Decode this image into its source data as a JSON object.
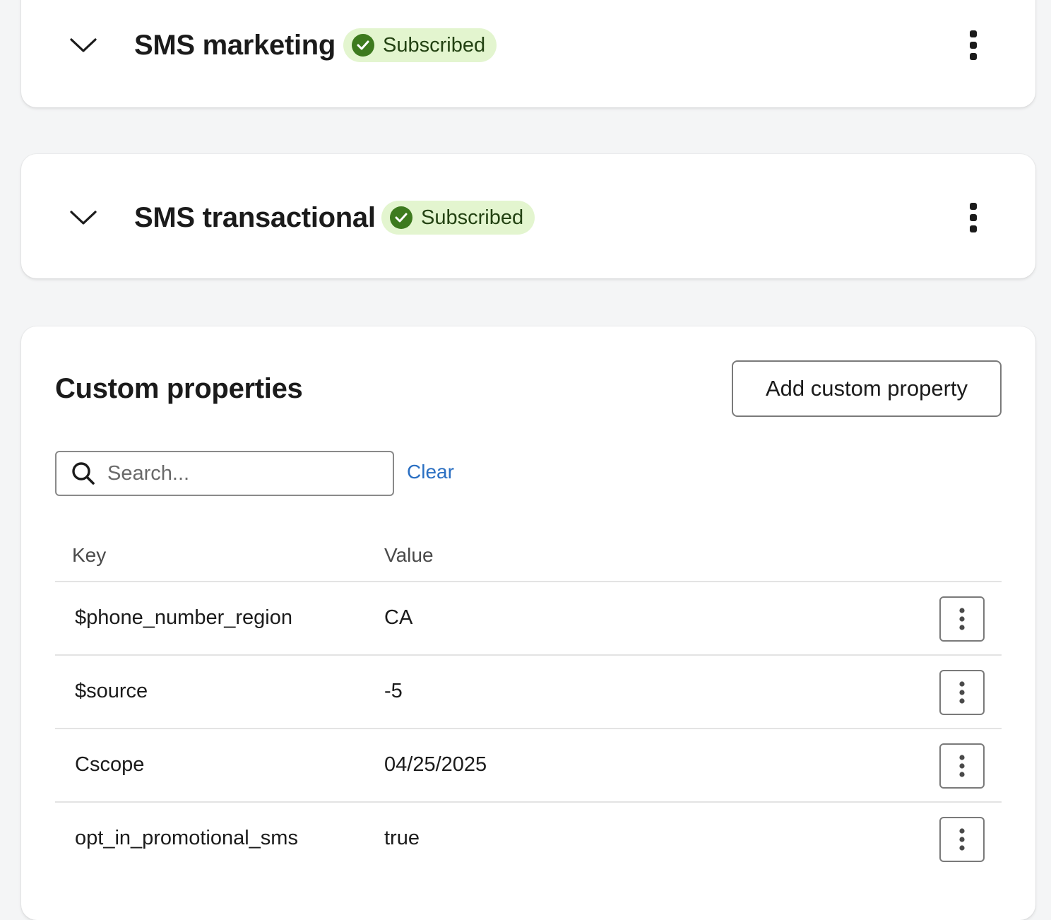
{
  "channels": [
    {
      "title": "SMS marketing",
      "status": "Subscribed"
    },
    {
      "title": "SMS transactional",
      "status": "Subscribed"
    }
  ],
  "custom_properties": {
    "title": "Custom properties",
    "add_button_label": "Add custom property",
    "search": {
      "placeholder": "Search...",
      "value": ""
    },
    "clear_label": "Clear",
    "columns": {
      "key": "Key",
      "value": "Value"
    },
    "rows": [
      {
        "key": "$phone_number_region",
        "value": "CA"
      },
      {
        "key": "$source",
        "value": "-5"
      },
      {
        "key": "Cscope",
        "value": "04/25/2025"
      },
      {
        "key": "opt_in_promotional_sms",
        "value": "true"
      }
    ]
  },
  "colors": {
    "badge_bg": "#e3f5cf",
    "badge_check": "#3d7a1e",
    "link": "#2a6fc2",
    "page_bg": "#f4f5f6"
  },
  "icons": {
    "expand": "chevron-down-icon",
    "more": "kebab-menu-icon",
    "status": "check-circle-icon",
    "search": "search-icon"
  }
}
